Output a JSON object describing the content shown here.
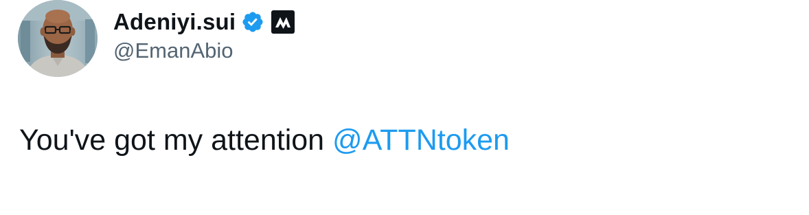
{
  "author": {
    "display_name": "Adeniyi.sui",
    "handle": "@EmanAbio",
    "avatar_icon": "profile-photo",
    "verified_icon": "verified-badge-icon",
    "affiliate_icon": "affiliate-logo-icon"
  },
  "tweet": {
    "text": "You've got my attention ",
    "mention": "@ATTNtoken"
  },
  "colors": {
    "text": "#0f1419",
    "secondary": "#536471",
    "link": "#1d9bf0",
    "verified": "#1d9bf0"
  }
}
